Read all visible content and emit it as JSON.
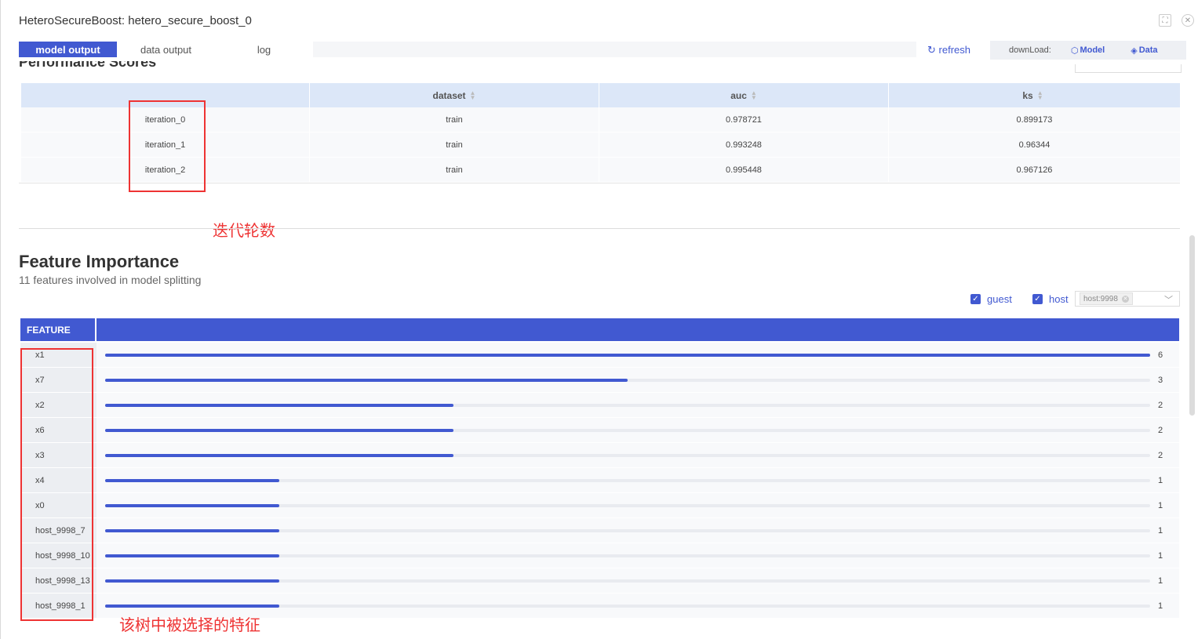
{
  "window": {
    "title": "HeteroSecureBoost: hetero_secure_boost_0"
  },
  "tabs": [
    {
      "label": "model output",
      "active": true
    },
    {
      "label": "data output",
      "active": false
    },
    {
      "label": "log",
      "active": false
    }
  ],
  "toolbar": {
    "refresh_label": "refresh",
    "download_label": "downLoad:",
    "model_label": "Model",
    "data_label": "Data"
  },
  "performance": {
    "columns": [
      "",
      "dataset",
      "auc",
      "ks"
    ],
    "rows": [
      [
        "iteration_0",
        "train",
        "0.978721",
        "0.899173"
      ],
      [
        "iteration_1",
        "train",
        "0.993248",
        "0.96344"
      ],
      [
        "iteration_2",
        "train",
        "0.995448",
        "0.967126"
      ]
    ]
  },
  "annotations": {
    "iterations_note": "迭代轮数",
    "features_note": "该树中被选择的特征"
  },
  "feature_importance": {
    "title": "Feature Importance",
    "subtitle": "11 features involved in model splitting",
    "guest_label": "guest",
    "host_label": "host",
    "host_tag": "host:9998",
    "column_header": "FEATURE",
    "max_value": 6
  },
  "chart_data": {
    "type": "bar",
    "categories": [
      "x1",
      "x7",
      "x2",
      "x6",
      "x3",
      "x4",
      "x0",
      "host_9998_7",
      "host_9998_10",
      "host_9998_13",
      "host_9998_1"
    ],
    "values": [
      6,
      3,
      2,
      2,
      2,
      1,
      1,
      1,
      1,
      1,
      1
    ],
    "orientation": "horizontal",
    "colors": {
      "bar": "#4159d1",
      "track": "#e9ebf0"
    }
  },
  "colors": {
    "accent": "#4159d1",
    "highlight": "#e33333",
    "table_header": "#dce7f8"
  }
}
